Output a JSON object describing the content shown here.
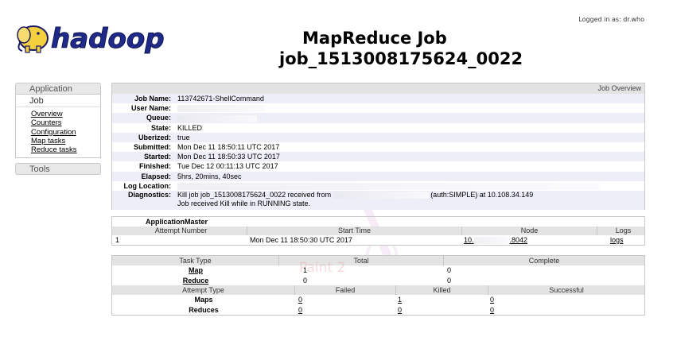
{
  "header": {
    "logged_in": "Logged in as: dr.who",
    "title_line1": "MapReduce Job",
    "title_line2": "job_1513008175624_0022",
    "logo_text": "hadoop"
  },
  "sidebar": {
    "application": "Application",
    "job": "Job",
    "links": [
      "Overview",
      "Counters",
      "Configuration",
      "Map tasks",
      "Reduce tasks"
    ],
    "tools": "Tools"
  },
  "overview": {
    "header": "Job Overview",
    "rows": [
      {
        "k": "Job Name:",
        "v": "113742671-ShellCommand"
      },
      {
        "k": "User Name:",
        "v": ""
      },
      {
        "k": "Queue:",
        "v": ""
      },
      {
        "k": "State:",
        "v": "KILLED"
      },
      {
        "k": "Uberized:",
        "v": "true"
      },
      {
        "k": "Submitted:",
        "v": "Mon Dec 11 18:50:11 UTC 2017"
      },
      {
        "k": "Started:",
        "v": "Mon Dec 11 18:50:33 UTC 2017"
      },
      {
        "k": "Finished:",
        "v": "Tue Dec 12 00:11:13 UTC 2017"
      },
      {
        "k": "Elapsed:",
        "v": "5hrs, 20mins, 40sec"
      },
      {
        "k": "Log Location:",
        "v": ""
      }
    ],
    "diagnostics_label": "Diagnostics:",
    "diagnostics_line1_a": "Kill job job_1513008175624_0022 received from",
    "diagnostics_line1_b": "(auth:SIMPLE) at 10.108.34.149",
    "diagnostics_line2": "Job received Kill while in RUNNING state."
  },
  "am": {
    "title": "ApplicationMaster",
    "headers": [
      "Attempt Number",
      "Start Time",
      "Node",
      "Logs"
    ],
    "row": {
      "attempt": "1",
      "start": "Mon Dec 11 18:50:30 UTC 2017",
      "node_a": "10.",
      "node_b": ".8042",
      "logs": "logs"
    }
  },
  "tasks": {
    "headers": [
      "Task Type",
      "Total",
      "Complete"
    ],
    "rows": [
      {
        "type": "Map",
        "total": "1",
        "complete": "0"
      },
      {
        "type": "Reduce",
        "total": "0",
        "complete": "0"
      }
    ],
    "attempt_headers": [
      "Attempt Type",
      "Failed",
      "Killed",
      "Successful"
    ],
    "attempt_rows": [
      {
        "type": "Maps",
        "failed": "0",
        "killed": "1",
        "successful": "0"
      },
      {
        "type": "Reduces",
        "failed": "0",
        "killed": "0",
        "successful": "0"
      }
    ],
    "watermark": "Paint 2"
  }
}
